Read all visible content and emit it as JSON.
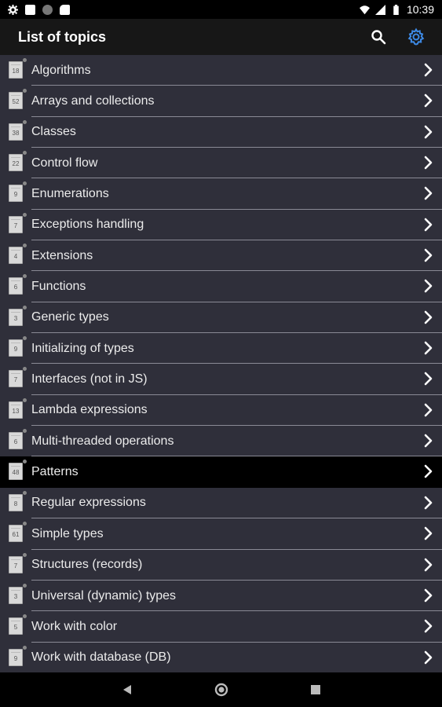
{
  "status_bar": {
    "time": "10:39",
    "left_icons": [
      "settings-icon",
      "notification-icon",
      "circle-icon",
      "sd-card-icon"
    ],
    "right_icons": [
      "wifi-icon",
      "signal-icon",
      "battery-icon"
    ]
  },
  "app_bar": {
    "title": "List of topics",
    "search_icon": "search-icon",
    "settings_icon": "gear-icon",
    "accent_color": "#3d8ae6"
  },
  "topics": [
    {
      "label": "Algorithms",
      "count": "18"
    },
    {
      "label": "Arrays and collections",
      "count": "52"
    },
    {
      "label": "Classes",
      "count": "38"
    },
    {
      "label": "Control flow",
      "count": "22"
    },
    {
      "label": "Enumerations",
      "count": "9"
    },
    {
      "label": "Exceptions handling",
      "count": "7"
    },
    {
      "label": "Extensions",
      "count": "4"
    },
    {
      "label": "Functions",
      "count": "6"
    },
    {
      "label": "Generic types",
      "count": "3"
    },
    {
      "label": "Initializing of types",
      "count": "9"
    },
    {
      "label": "Interfaces (not in JS)",
      "count": "7"
    },
    {
      "label": "Lambda expressions",
      "count": "13"
    },
    {
      "label": "Multi-threaded operations",
      "count": "6"
    },
    {
      "label": "Patterns",
      "count": "48",
      "selected": true
    },
    {
      "label": "Regular expressions",
      "count": "8"
    },
    {
      "label": "Simple types",
      "count": "61"
    },
    {
      "label": "Structures (records)",
      "count": "7"
    },
    {
      "label": "Universal (dynamic) types",
      "count": "3"
    },
    {
      "label": "Work with color",
      "count": "5"
    },
    {
      "label": "Work with database (DB)",
      "count": "9"
    }
  ],
  "nav_bar": {
    "buttons": [
      "back-icon",
      "home-icon",
      "recents-icon"
    ]
  }
}
